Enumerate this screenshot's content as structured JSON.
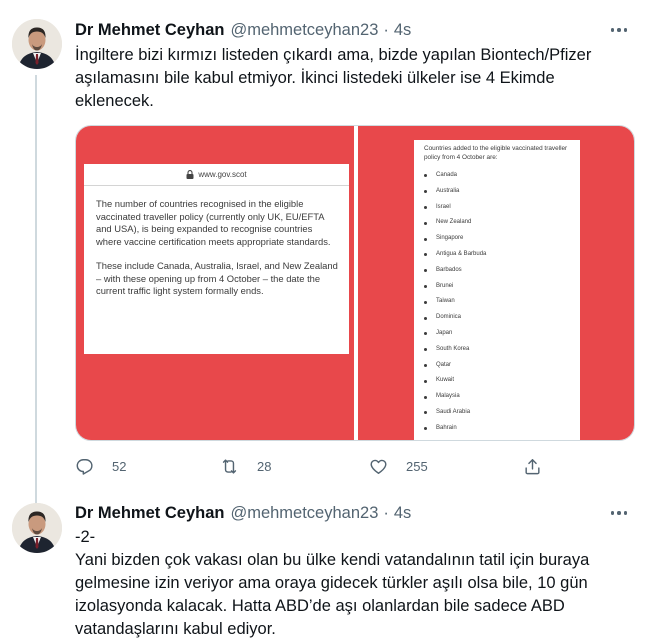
{
  "tweets": [
    {
      "author_name": "Dr Mehmet Ceyhan",
      "handle": "@mehmetceyhan23",
      "separator": "·",
      "time": "4s",
      "text_lines": [
        "İngiltere bizi kırmızı listeden çıkardı ama, bizde yapılan Biontech/Pfizer",
        "aşılamasını bile kabul etmiyor. İkinci listedeki ülkeler ise 4 Ekimde",
        "eklenecek."
      ],
      "media": {
        "left_image": {
          "url": "www.gov.scot",
          "paragraph1": "The number of countries recognised in the eligible vaccinated traveller policy (currently only UK, EU/EFTA and USA), is being expanded to recognise countries where vaccine certification meets appropriate standards.",
          "paragraph2": "These include Canada, Australia, Israel, and New Zealand – with these opening up from 4 October – the date the current traffic light system formally ends."
        },
        "right_image": {
          "title": "Countries added to the eligible vaccinated traveller policy from 4 October are:",
          "countries": [
            "Canada",
            "Australia",
            "Israel",
            "New Zealand",
            "Singapore",
            "Antigua & Barbuda",
            "Barbados",
            "Brunei",
            "Taiwan",
            "Dominica",
            "Japan",
            "South Korea",
            "Qatar",
            "Kuwait",
            "Malaysia",
            "Saudi Arabia",
            "Bahrain"
          ]
        }
      },
      "stats": {
        "replies": "52",
        "retweets": "28",
        "likes": "255"
      }
    },
    {
      "author_name": "Dr Mehmet Ceyhan",
      "handle": "@mehmetceyhan23",
      "separator": "·",
      "time": "4s",
      "text_lines": [
        "-2-",
        "Yani bizden çok vakası olan bu ülke kendi vatandalının tatil için buraya",
        "gelmesine izin veriyor ama oraya gidecek türkler aşılı olsa bile, 10 gün",
        "izolasyonda kalacak. Hatta ABD’de aşı olanlardan bile sadece ABD",
        "vatandaşlarını kabul ediyor."
      ]
    }
  ],
  "icons": {
    "reply": "reply-icon",
    "retweet": "retweet-icon",
    "like": "heart-icon",
    "share": "share-icon",
    "more": "more-icon",
    "lock": "lock-icon"
  },
  "colors": {
    "media_background": "#e8484b",
    "secondary_text": "#536471",
    "thread_line": "#cfd9de"
  }
}
